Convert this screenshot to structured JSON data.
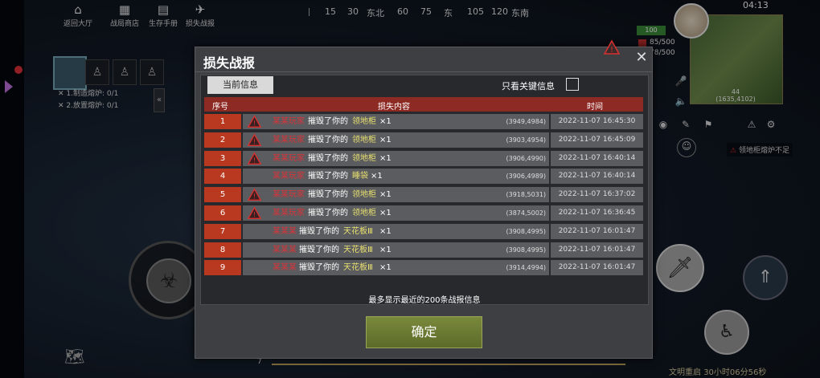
{
  "top_nav": [
    {
      "label": "返回大厅",
      "icon": "home-icon"
    },
    {
      "label": "战局商店",
      "icon": "shop-icon"
    },
    {
      "label": "生存手册",
      "icon": "book-icon"
    },
    {
      "label": "损失战报",
      "icon": "loss-report-icon"
    }
  ],
  "compass": {
    "marks": [
      "15",
      "30",
      "东北",
      "60",
      "75",
      "东",
      "105",
      "120",
      "东南"
    ]
  },
  "status": {
    "clock": "04:13",
    "hp_badge": "100",
    "resource_1": "85/500",
    "resource_2": "78/500",
    "minimap_coord_line1": "44",
    "minimap_coord_line2": "(1635,4102)",
    "warning_text_suffix": "熔炉不足"
  },
  "quests": [
    {
      "text": "1.制造熔炉: 0/1"
    },
    {
      "text": "2.放置熔炉: 0/1"
    }
  ],
  "bottom": {
    "level": "7",
    "footer_label": "文明重启",
    "footer_time": "30小时06分56秒"
  },
  "dialog": {
    "title": "损失战报",
    "tab_current": "当前信息",
    "key_only_label": "只看关键信息",
    "key_only_checked": false,
    "columns": [
      "序号",
      "损失内容",
      "时间"
    ],
    "verb": "摧毁了你的",
    "rows": [
      {
        "no": "1",
        "warn": true,
        "actor": "某某玩家",
        "item": "领地柜",
        "item_color": "#e8e070",
        "count": "×1",
        "coord": "(3949,4984)",
        "time": "2022-11-07 16:45:30"
      },
      {
        "no": "2",
        "warn": true,
        "actor": "某某玩家",
        "item": "领地柜",
        "item_color": "#e8e070",
        "count": "×1",
        "coord": "(3903,4954)",
        "time": "2022-11-07 16:45:09"
      },
      {
        "no": "3",
        "warn": true,
        "actor": "某某玩家",
        "item": "领地柜",
        "item_color": "#e8e070",
        "count": "×1",
        "coord": "(3906,4990)",
        "time": "2022-11-07 16:40:14"
      },
      {
        "no": "4",
        "warn": false,
        "actor": "某某玩家",
        "item": "睡袋",
        "item_color": "#e8e070",
        "count": "×1",
        "coord": "(3906,4989)",
        "time": "2022-11-07 16:40:14"
      },
      {
        "no": "5",
        "warn": true,
        "actor": "某某玩家",
        "item": "领地柜",
        "item_color": "#e8e070",
        "count": "×1",
        "coord": "(3918,5031)",
        "time": "2022-11-07 16:37:02"
      },
      {
        "no": "6",
        "warn": true,
        "actor": "某某玩家",
        "item": "领地柜",
        "item_color": "#e8e070",
        "count": "×1",
        "coord": "(3874,5002)",
        "time": "2022-11-07 16:36:45"
      },
      {
        "no": "7",
        "warn": false,
        "actor": "某某某",
        "item": "天花板Ⅲ",
        "item_color": "#e8e070",
        "count": "×1",
        "coord": "(3908,4995)",
        "time": "2022-11-07 16:01:47"
      },
      {
        "no": "8",
        "warn": false,
        "actor": "某某某",
        "item": "天花板Ⅲ",
        "item_color": "#e8e070",
        "count": "×1",
        "coord": "(3908,4995)",
        "time": "2022-11-07 16:01:47"
      },
      {
        "no": "9",
        "warn": false,
        "actor": "某某某",
        "item": "天花板Ⅲ",
        "item_color": "#e8e070",
        "count": "×1",
        "coord": "(3914,4994)",
        "time": "2022-11-07 16:01:47"
      }
    ],
    "max_note": "最多显示最近的200条战报信息",
    "confirm_label": "确定"
  },
  "colors": {
    "accent_red": "#b8391f",
    "header_red": "#8e2a24",
    "confirm_green": "#6b7a32",
    "item_yellow": "#e8e070",
    "actor_red": "#d9343a"
  }
}
